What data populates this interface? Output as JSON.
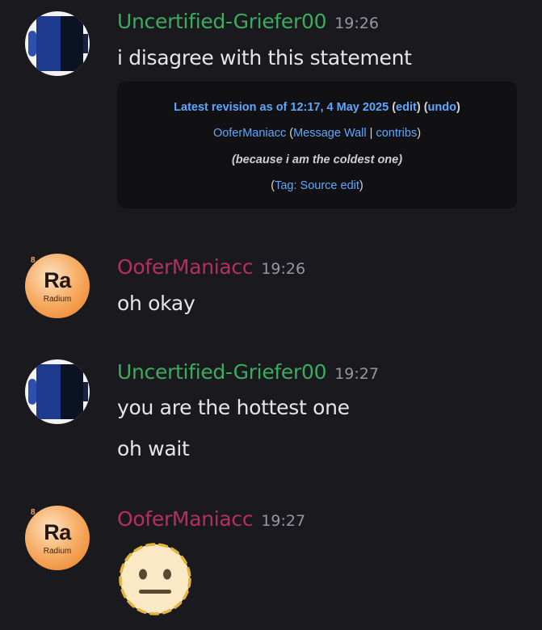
{
  "messages": [
    {
      "username": "Uncertified-Griefer00",
      "time": "19:26",
      "lines": [
        "i disagree with this statement"
      ],
      "user_color": "#3bab5f",
      "embed": {
        "revision_label": "Latest revision as of 12:17, 4 May 2025",
        "edit_link": "edit",
        "undo_link": "undo",
        "author": "OoferManiacc",
        "message_wall": "Message Wall",
        "contribs": "contribs",
        "summary": "(because i am the coldest one)",
        "tag_label": "Tag:",
        "tag_value": "Source edit"
      }
    },
    {
      "username": "OoferManiacc",
      "time": "19:26",
      "lines": [
        "oh okay"
      ],
      "user_color": "#b3305f",
      "avatar": {
        "symbol": "Ra",
        "name": "Radium",
        "number": "8"
      }
    },
    {
      "username": "Uncertified-Griefer00",
      "time": "19:27",
      "lines": [
        "you are the hottest one",
        "oh wait"
      ],
      "user_color": "#3bab5f"
    },
    {
      "username": "OoferManiacc",
      "time": "19:27",
      "emoji": "dotted-line-neutral-face",
      "user_color": "#b3305f",
      "avatar": {
        "symbol": "Ra",
        "name": "Radium",
        "number": "8"
      }
    }
  ],
  "icons": {
    "avatar_1": "blue-shield-avatar",
    "avatar_2": "radium-element-avatar"
  }
}
